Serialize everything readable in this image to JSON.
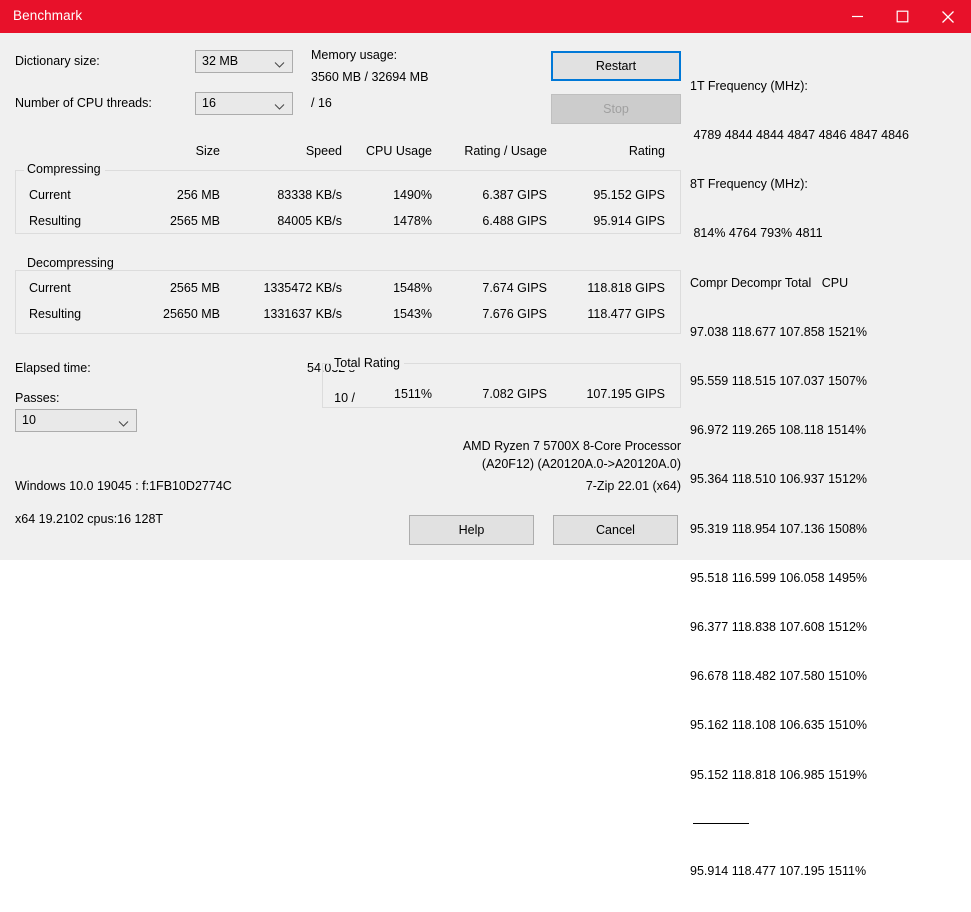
{
  "window": {
    "title": "Benchmark",
    "titlebar_color": "#e8112a",
    "accent_color": "#0078d7",
    "controls": {
      "minimize": "minimize-icon",
      "maximize": "maximize-icon",
      "close": "close-icon"
    }
  },
  "settings": {
    "dictionary_label": "Dictionary size:",
    "dictionary_value": "32 MB",
    "threads_label": "Number of CPU threads:",
    "threads_value": "16",
    "threads_max": "/ 16",
    "memory_label": "Memory usage:",
    "memory_value": "3560 MB / 32694 MB"
  },
  "actions": {
    "restart": "Restart",
    "stop": "Stop",
    "help": "Help",
    "cancel": "Cancel"
  },
  "columns": {
    "size": "Size",
    "speed": "Speed",
    "cpu_usage": "CPU Usage",
    "rating_usage": "Rating / Usage",
    "rating": "Rating"
  },
  "compressing": {
    "title": "Compressing",
    "rows": [
      {
        "label": "Current",
        "size": "256 MB",
        "speed": "83338 KB/s",
        "cpu_usage": "1490%",
        "rating_usage": "6.387 GIPS",
        "rating": "95.152 GIPS"
      },
      {
        "label": "Resulting",
        "size": "2565 MB",
        "speed": "84005 KB/s",
        "cpu_usage": "1478%",
        "rating_usage": "6.488 GIPS",
        "rating": "95.914 GIPS"
      }
    ]
  },
  "decompressing": {
    "title": "Decompressing",
    "rows": [
      {
        "label": "Current",
        "size": "2565 MB",
        "speed": "1335472 KB/s",
        "cpu_usage": "1548%",
        "rating_usage": "7.674 GIPS",
        "rating": "118.818 GIPS"
      },
      {
        "label": "Resulting",
        "size": "25650 MB",
        "speed": "1331637 KB/s",
        "cpu_usage": "1543%",
        "rating_usage": "7.676 GIPS",
        "rating": "118.477 GIPS"
      }
    ]
  },
  "progress": {
    "elapsed_label": "Elapsed time:",
    "elapsed_value": "54.032 s",
    "passes_label": "Passes:",
    "passes_value": "10 /",
    "passes_select": "10"
  },
  "total_rating": {
    "title": "Total Rating",
    "cpu_usage": "1511%",
    "rating_usage": "7.082 GIPS",
    "rating": "107.195 GIPS"
  },
  "log": {
    "freq_1t_label": "1T Frequency (MHz):",
    "freq_1t_values": " 4789 4844 4844 4847 4846 4847 4846",
    "freq_8t_label": "8T Frequency (MHz):",
    "freq_8t_values": " 814% 4764 793% 4811",
    "header": "Compr Decompr Total   CPU",
    "rows": [
      "97.038 118.677 107.858 1521%",
      "95.559 118.515 107.037 1507%",
      "96.972 119.265 108.118 1514%",
      "95.364 118.510 106.937 1512%",
      "95.319 118.954 107.136 1508%",
      "95.518 116.599 106.058 1495%",
      "96.377 118.838 107.608 1512%",
      "96.678 118.482 107.580 1510%",
      "95.162 118.108 106.635 1510%",
      "95.152 118.818 106.985 1519%"
    ],
    "average": "95.914 118.477 107.195 1511%"
  },
  "footer": {
    "cpu_name": "AMD Ryzen 7 5700X 8-Core Processor",
    "cpu_ids": "(A20F12) (A20120A.0->A20120A.0)",
    "os_info": "Windows 10.0 19045 : f:1FB10D2774C",
    "app_version": "7-Zip 22.01 (x64)",
    "build_info": "x64 19.2102 cpus:16 128T"
  }
}
